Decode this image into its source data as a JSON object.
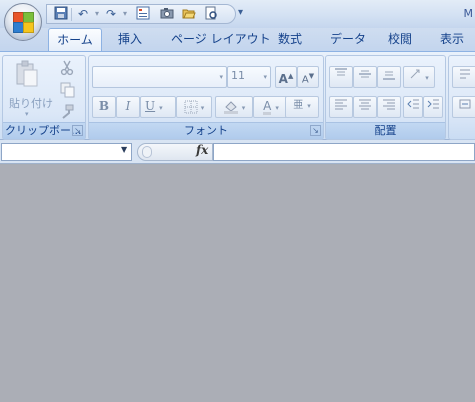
{
  "window": {
    "title_fragment": "M"
  },
  "qat": {
    "icons": [
      "save-icon",
      "undo-icon",
      "redo-icon",
      "form-icon",
      "camera-icon",
      "open-icon",
      "print-preview-icon"
    ],
    "more": "▾"
  },
  "tabs": [
    "ホーム",
    "挿入",
    "ページ レイアウト",
    "数式",
    "データ",
    "校閲",
    "表示"
  ],
  "clipboard": {
    "paste_label": "貼り付け",
    "group_label": "クリップボー..."
  },
  "font": {
    "font_name": "",
    "font_size": "11",
    "bold": "B",
    "italic": "I",
    "underline": "U",
    "grow": "A",
    "shrink": "A",
    "font_color_letter": "A",
    "phonetic": "亜",
    "group_label": "フォント"
  },
  "alignment": {
    "group_label": "配置"
  },
  "formula_bar": {
    "name_box": "",
    "fx": "fx",
    "formula": ""
  }
}
